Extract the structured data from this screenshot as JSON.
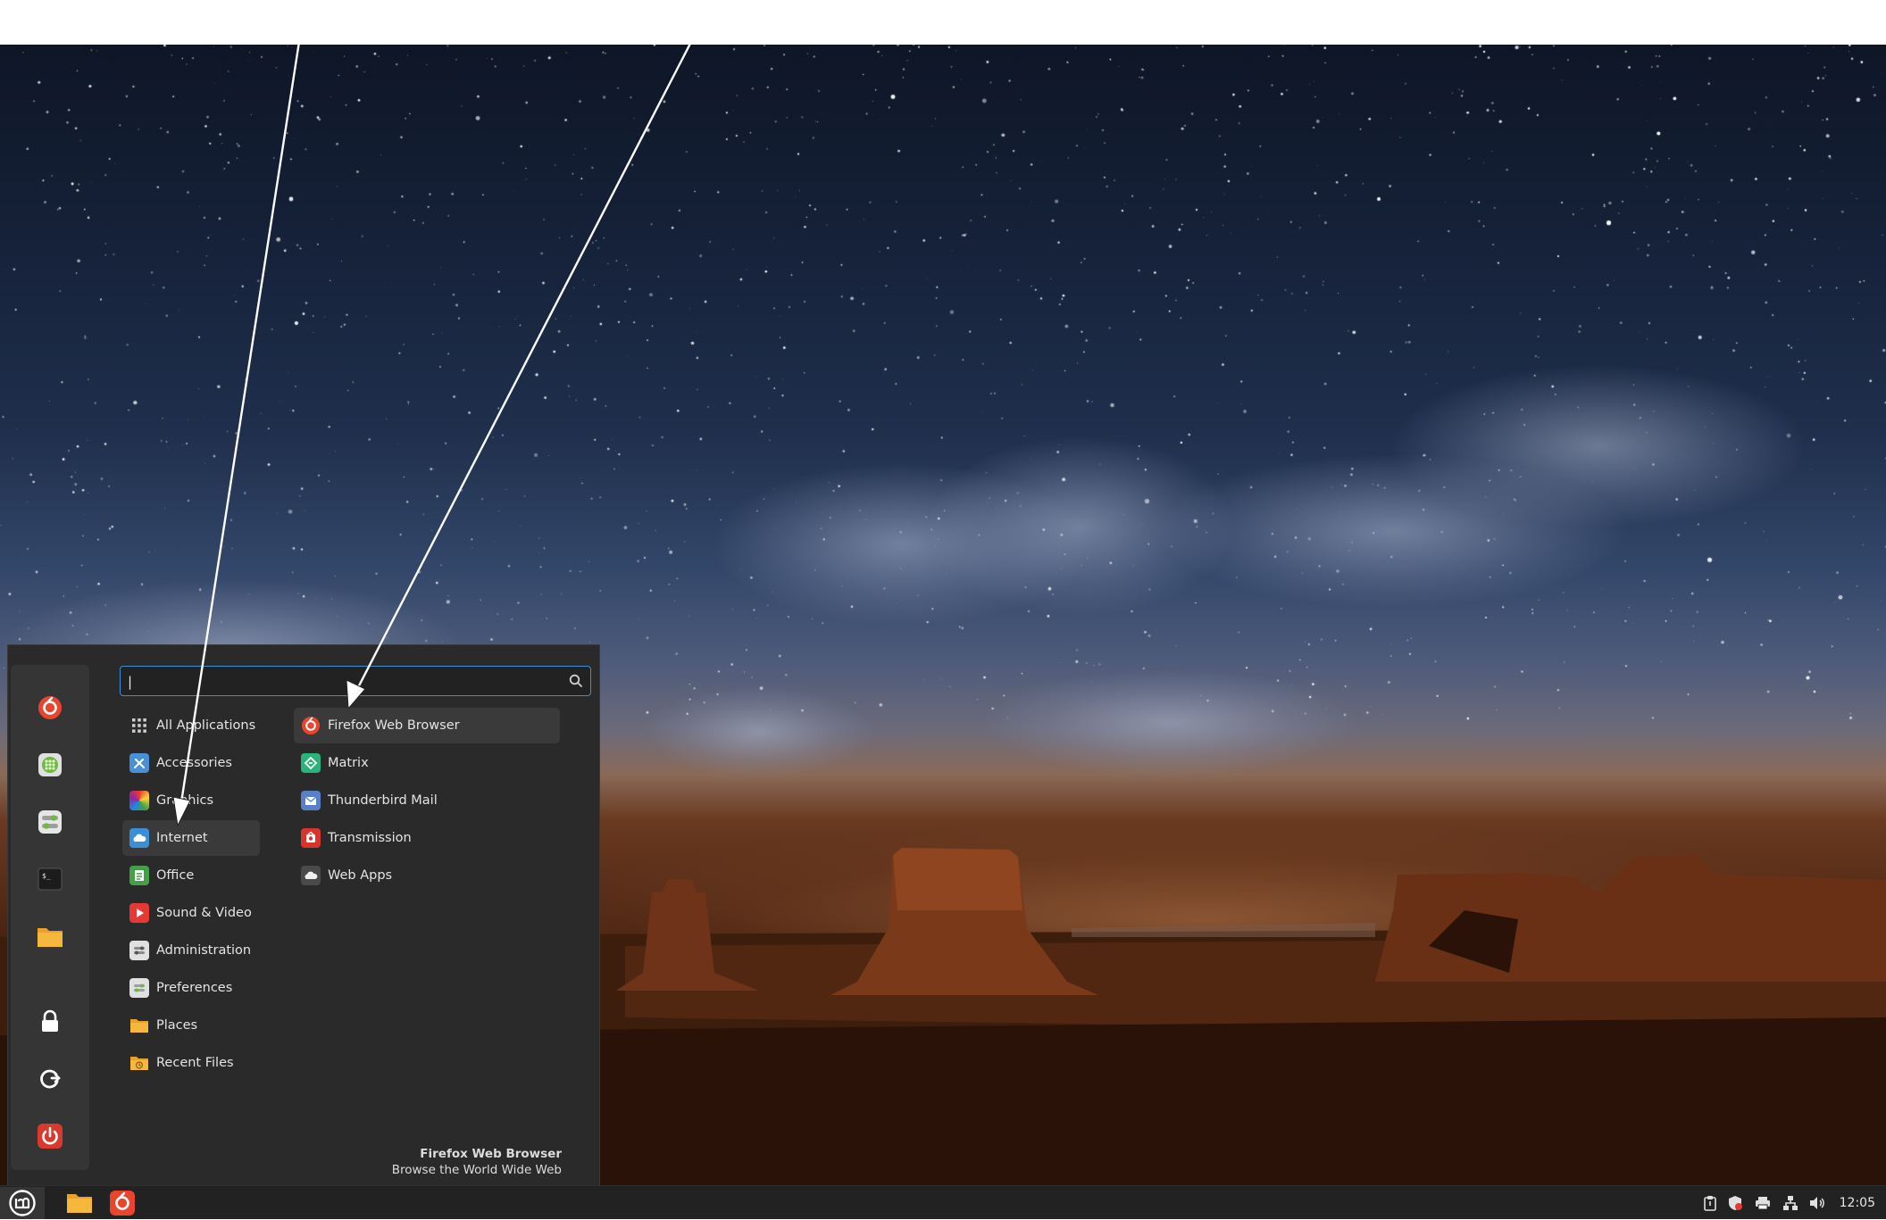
{
  "search": {
    "value": "|",
    "placeholder": ""
  },
  "categories": [
    {
      "label": "All Applications",
      "icon": "grid-icon"
    },
    {
      "label": "Accessories",
      "icon": "accessories-icon"
    },
    {
      "label": "Graphics",
      "icon": "graphics-icon"
    },
    {
      "label": "Internet",
      "icon": "internet-icon",
      "selected": true
    },
    {
      "label": "Office",
      "icon": "office-icon"
    },
    {
      "label": "Sound & Video",
      "icon": "media-icon"
    },
    {
      "label": "Administration",
      "icon": "administration-icon"
    },
    {
      "label": "Preferences",
      "icon": "preferences-icon"
    },
    {
      "label": "Places",
      "icon": "folder-icon"
    },
    {
      "label": "Recent Files",
      "icon": "recent-files-icon"
    }
  ],
  "apps": [
    {
      "label": "Firefox Web Browser",
      "icon": "firefox-icon",
      "selected": true
    },
    {
      "label": "Matrix",
      "icon": "matrix-icon"
    },
    {
      "label": "Thunderbird Mail",
      "icon": "thunderbird-icon"
    },
    {
      "label": "Transmission",
      "icon": "transmission-icon"
    },
    {
      "label": "Web Apps",
      "icon": "webapps-icon"
    }
  ],
  "favorites": [
    {
      "name": "firefox-icon"
    },
    {
      "name": "software-manager-icon"
    },
    {
      "name": "settings-icon"
    },
    {
      "name": "terminal-icon"
    },
    {
      "name": "files-icon"
    },
    {
      "name": "lock-icon"
    },
    {
      "name": "logout-icon"
    },
    {
      "name": "power-icon"
    }
  ],
  "footer": {
    "title": "Firefox Web Browser",
    "description": "Browse the World Wide Web"
  },
  "taskbar": {
    "clock": "12:05",
    "tray": [
      "clipboard-icon",
      "update-shield-icon",
      "printer-icon",
      "network-icon",
      "volume-icon"
    ]
  },
  "colors": {
    "menu_bg": "#2a2a2a",
    "favbar_bg": "#353535",
    "accent": "#3d8fd1",
    "selected_bg": "#3a3a3a",
    "taskbar_bg": "#222222",
    "firefox": "#e8452c",
    "mint_green": "#8bc34a",
    "power_red": "#d83b2e",
    "folder": "#f5b83d"
  }
}
